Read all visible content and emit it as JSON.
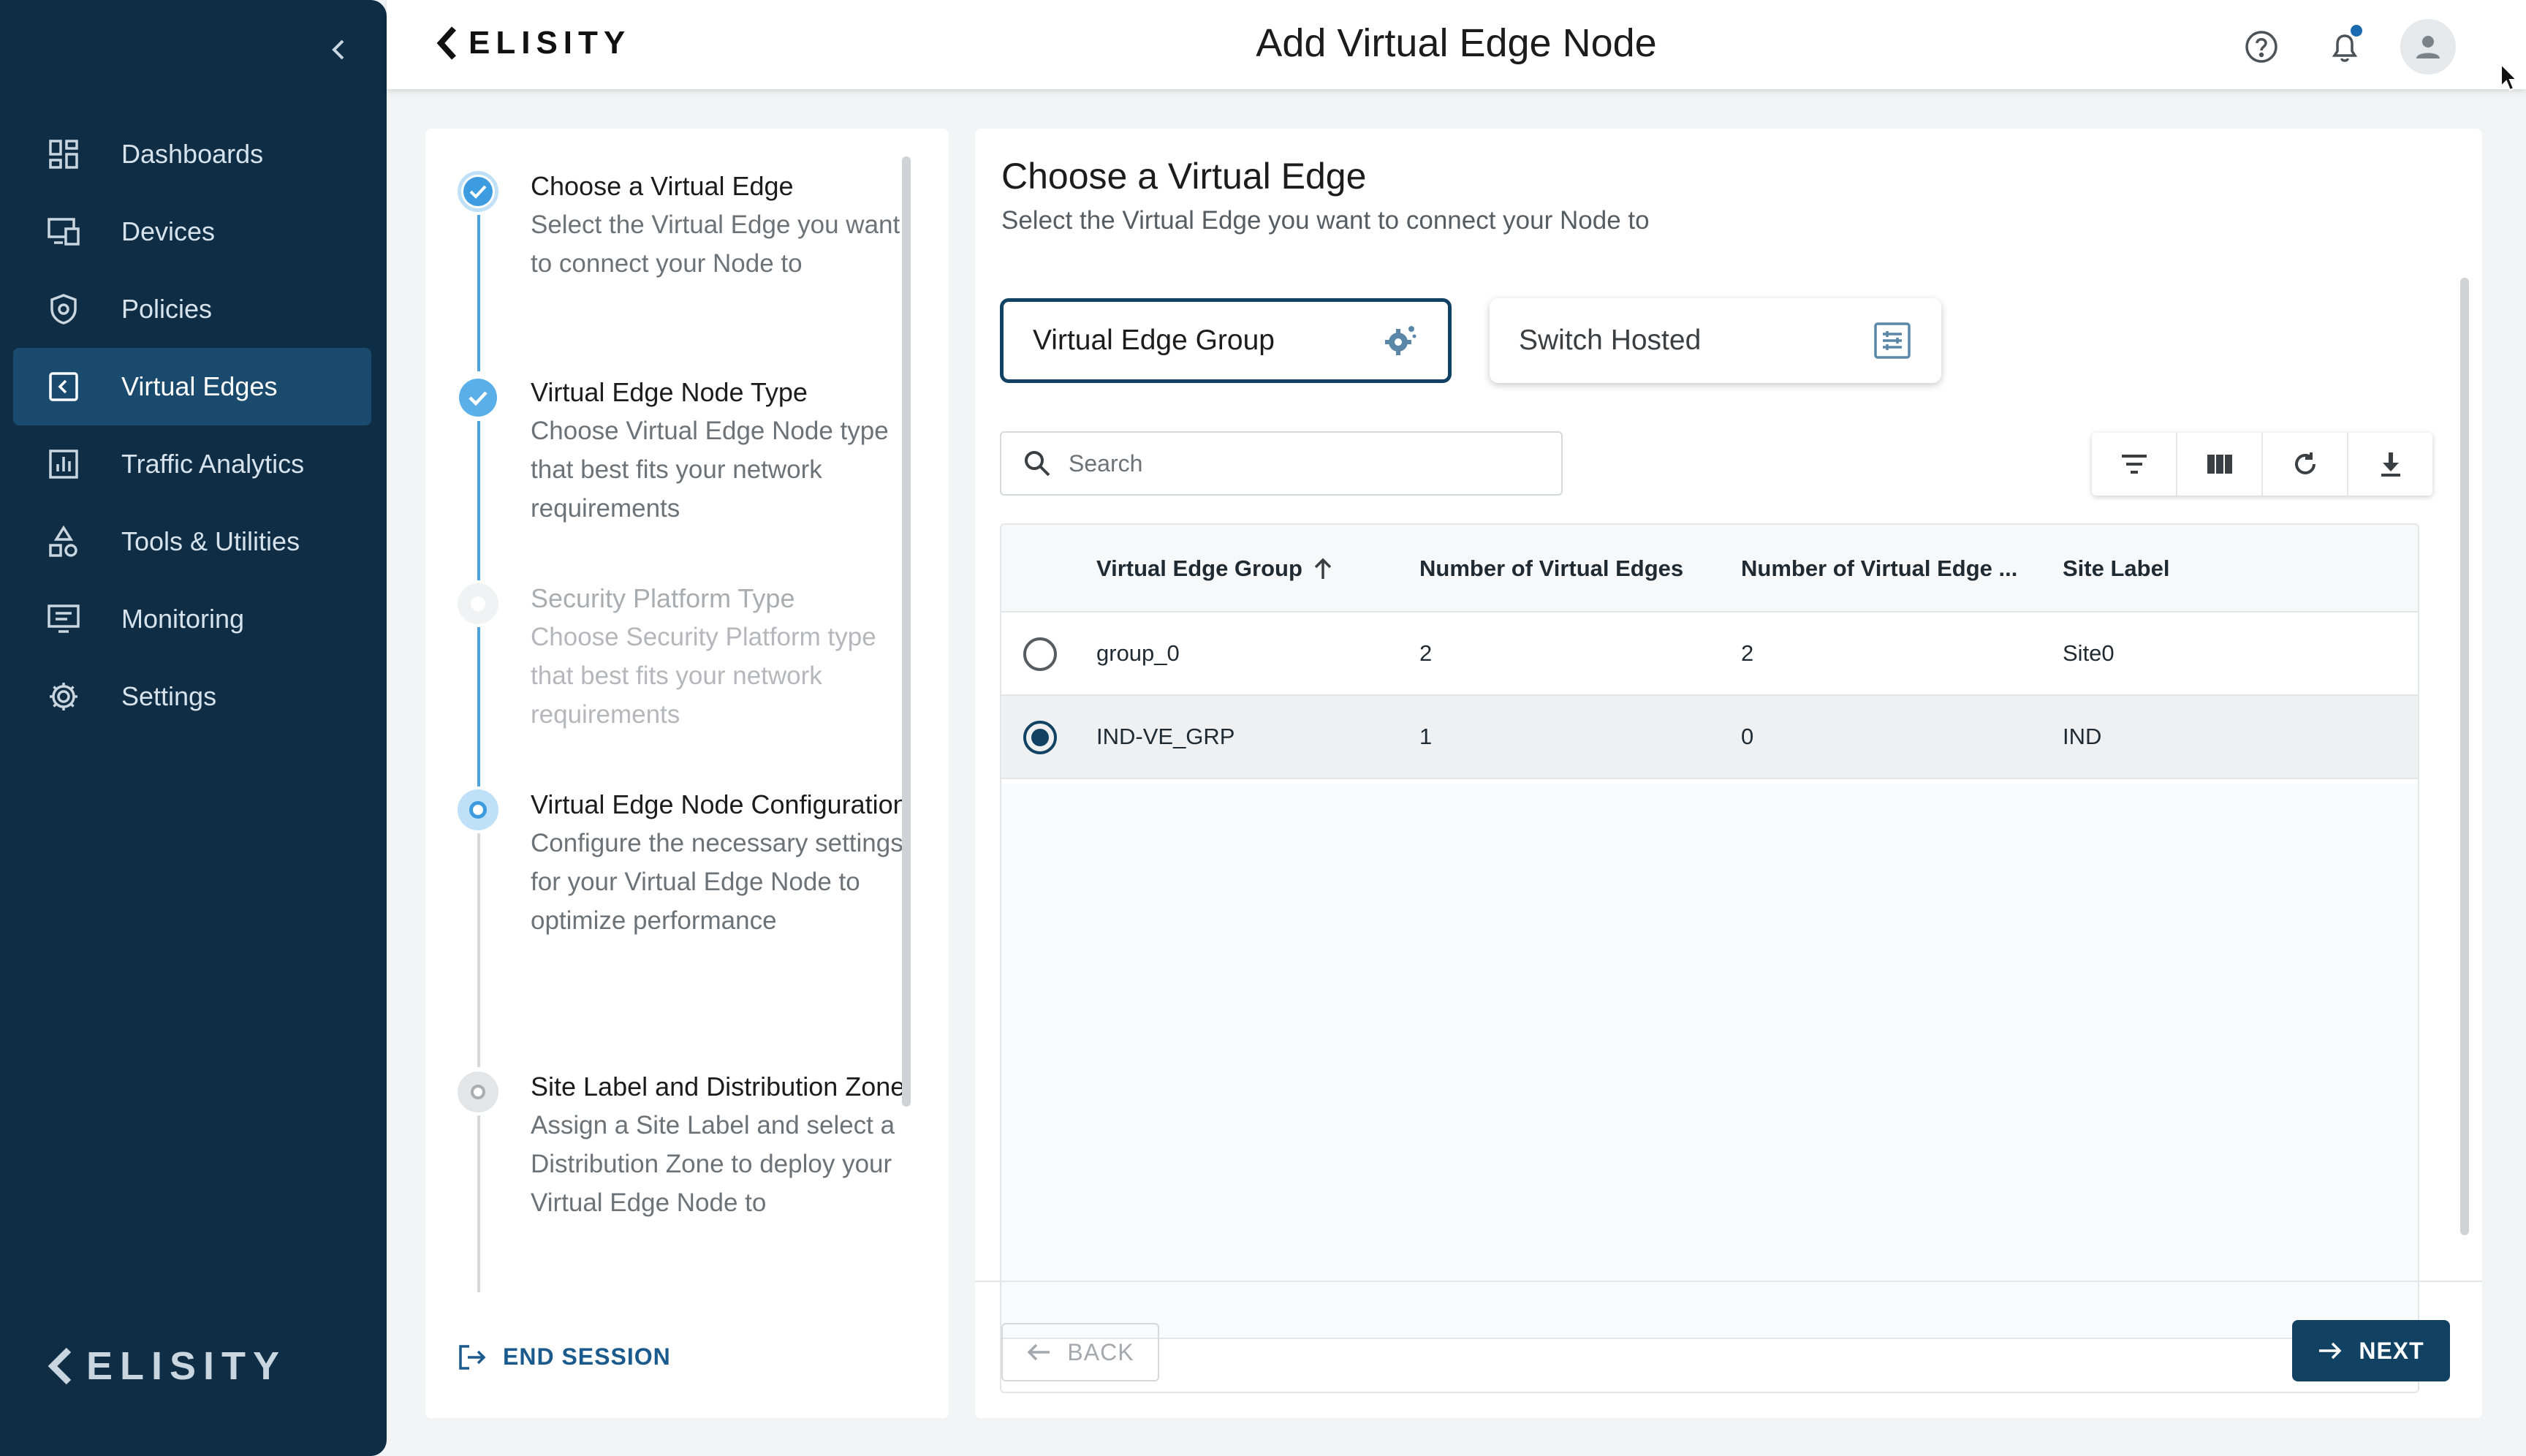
{
  "brand": {
    "name": "ELISITY",
    "accent": "#124263",
    "sidebar_bg": "#0f2d44"
  },
  "sidebar": {
    "collapse_icon": "chevron-left-icon",
    "items": [
      {
        "label": "Dashboards",
        "icon": "dashboard-icon",
        "active": false
      },
      {
        "label": "Devices",
        "icon": "devices-icon",
        "active": false
      },
      {
        "label": "Policies",
        "icon": "shield-icon",
        "active": false
      },
      {
        "label": "Virtual Edges",
        "icon": "virtual-edge-icon",
        "active": true
      },
      {
        "label": "Traffic Analytics",
        "icon": "bar-chart-icon",
        "active": false
      },
      {
        "label": "Tools & Utilities",
        "icon": "shapes-icon",
        "active": false
      },
      {
        "label": "Monitoring",
        "icon": "monitor-icon",
        "active": false
      },
      {
        "label": "Settings",
        "icon": "gear-icon",
        "active": false
      }
    ]
  },
  "header": {
    "title": "Add Virtual Edge Node",
    "icons": [
      "help-icon",
      "bell-icon",
      "user-avatar-icon"
    ]
  },
  "stepper": {
    "steps": [
      {
        "title": "Choose a Virtual Edge",
        "description": "Select the Virtual Edge you want to connect your Node to",
        "state": "current-complete"
      },
      {
        "title": "Virtual Edge Node Type",
        "description": "Choose Virtual Edge Node type that best fits your network requirements",
        "state": "complete"
      },
      {
        "title": "Security Platform Type",
        "description": "Choose Security Platform type that best fits your network requirements",
        "state": "disabled"
      },
      {
        "title": "Virtual Edge Node Configuration",
        "description": "Configure the necessary settings for your Virtual Edge Node to optimize performance",
        "state": "upcoming"
      },
      {
        "title": "Site Label and Distribution Zone",
        "description": "Assign a Site Label and select a Distribution Zone to deploy your Virtual Edge Node to",
        "state": "upcoming"
      }
    ],
    "end_session": "END SESSION"
  },
  "main": {
    "title": "Choose a Virtual Edge",
    "subtitle": "Select the Virtual Edge you want to connect your Node to",
    "tabs": [
      {
        "label": "Virtual Edge Group",
        "icon": "gear-group-icon",
        "selected": true
      },
      {
        "label": "Switch Hosted",
        "icon": "switch-icon",
        "selected": false
      }
    ],
    "search_placeholder": "Search",
    "toolbar": [
      "filter-icon",
      "columns-icon",
      "refresh-icon",
      "download-icon"
    ],
    "table": {
      "columns": [
        "Virtual Edge Group",
        "Number of Virtual Edges",
        "Number of Virtual Edge ...",
        "Site Label"
      ],
      "rows": [
        {
          "cells": [
            "group_0",
            "2",
            "2",
            "Site0"
          ],
          "selected": false
        },
        {
          "cells": [
            "IND-VE_GRP",
            "1",
            "0",
            "IND"
          ],
          "selected": true
        }
      ]
    },
    "back_label": "BACK",
    "next_label": "NEXT"
  }
}
